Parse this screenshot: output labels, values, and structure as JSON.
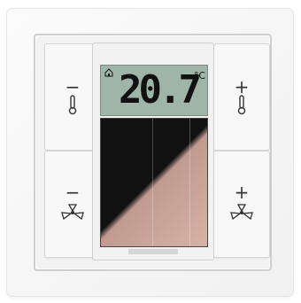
{
  "display": {
    "temperature": "20.7",
    "unit": "°C",
    "mode_icon": "house-icon"
  },
  "buttons": {
    "temp_minus": {
      "sign": "−",
      "icon": "thermometer-icon"
    },
    "temp_plus": {
      "sign": "+",
      "icon": "thermometer-icon"
    },
    "fan_minus": {
      "sign": "−",
      "icon": "fan-icon"
    },
    "fan_plus": {
      "sign": "+",
      "icon": "fan-icon"
    }
  },
  "colors": {
    "lcd": "#9fb5a8",
    "solar_dark": "#111111",
    "solar_light": "#d9b2a6"
  }
}
